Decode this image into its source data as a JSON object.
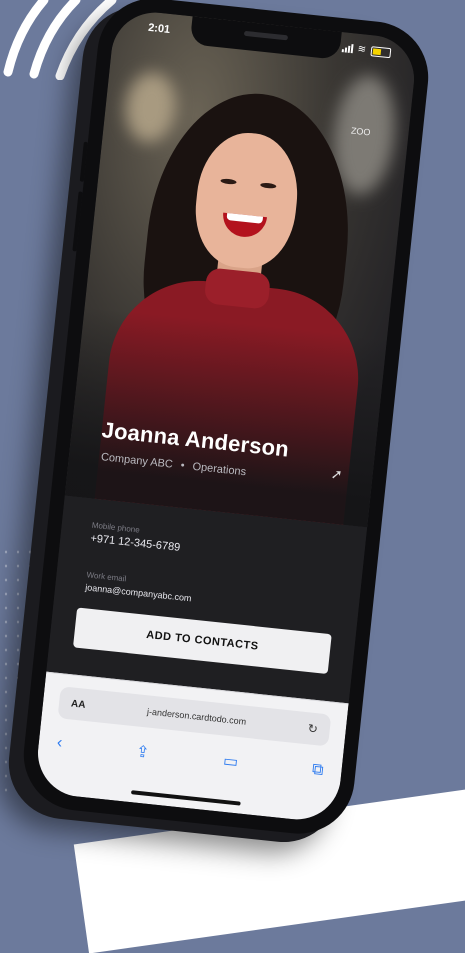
{
  "status_bar": {
    "time": "2:01"
  },
  "profile": {
    "name": "Joanna Anderson",
    "company": "Company ABC",
    "department": "Operations",
    "top_right_label": "ZOO"
  },
  "fields": {
    "phone_label": "Mobile phone",
    "phone_value": "+971 12-345-6789",
    "email_label": "Work email",
    "email_value": "joanna@companyabc.com"
  },
  "actions": {
    "add_contacts_label": "ADD TO CONTACTS"
  },
  "browser": {
    "aa_label": "AA",
    "url": "j-anderson.cardtodo.com"
  },
  "colors": {
    "background": "#6c7a9c",
    "sweater": "#8a1a24",
    "accent_blue": "#2d7bf0"
  },
  "icons": {
    "share": "share-icon",
    "reload": "reload-icon",
    "back": "back-icon",
    "upload": "share-icon",
    "book": "bookmarks-icon",
    "tabs": "tabs-icon"
  }
}
